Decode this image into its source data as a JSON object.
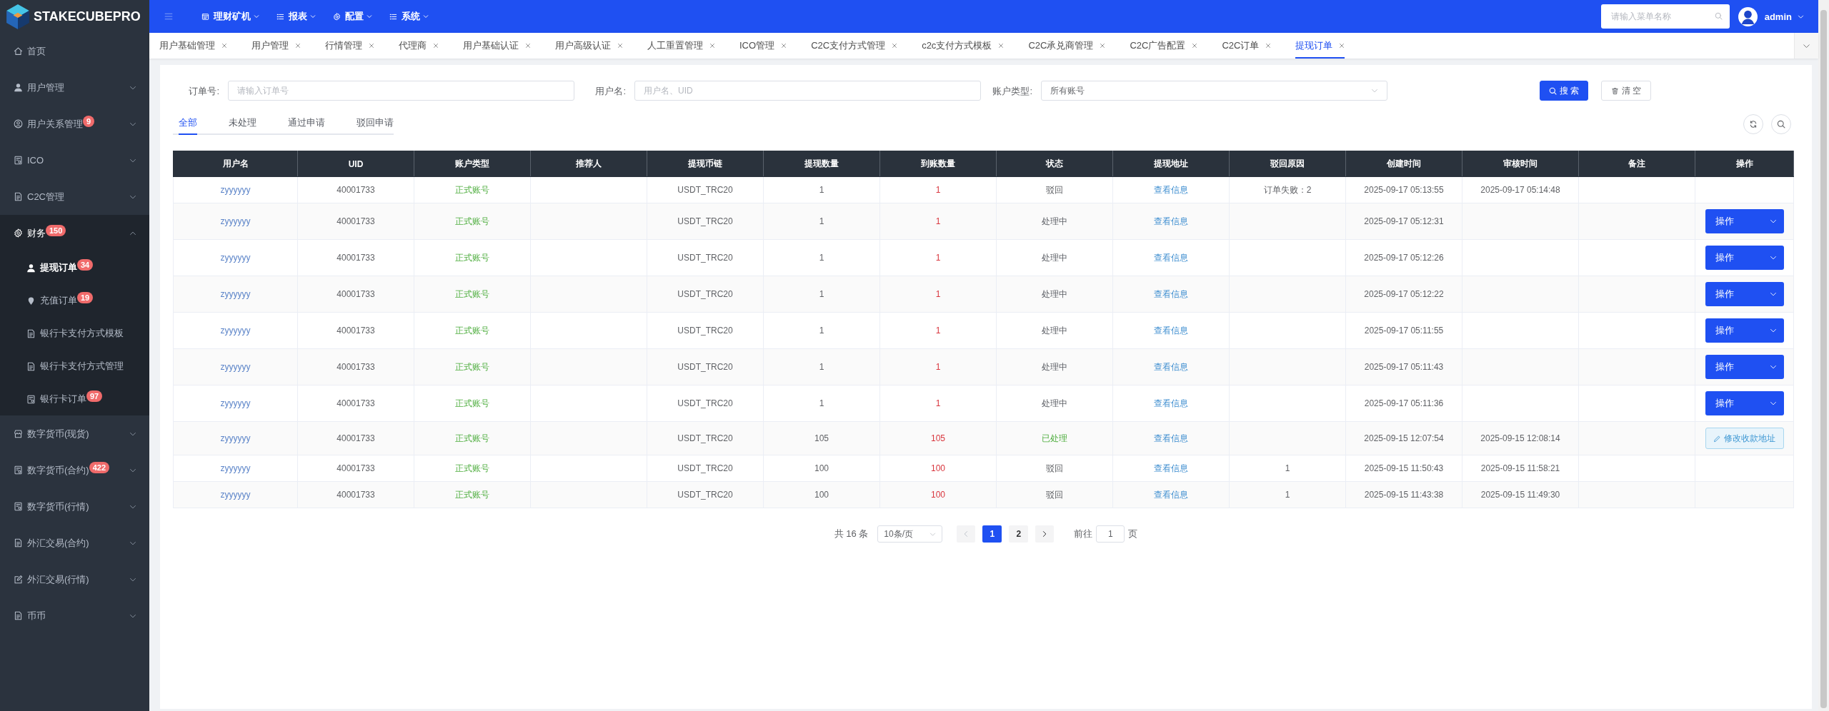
{
  "header": {
    "logo_text": "STAKECUBEPRO",
    "menu": [
      {
        "label": "理财矿机"
      },
      {
        "label": "报表"
      },
      {
        "label": "配置"
      },
      {
        "label": "系统"
      }
    ],
    "menu_search": {
      "placeholder": "请输入菜单名称"
    },
    "user": {
      "name": "admin"
    }
  },
  "sidebar": {
    "items": [
      {
        "label": "首页",
        "selected": false
      },
      {
        "label": "用户管理",
        "selected": false,
        "expanded": false
      },
      {
        "label": "用户关系管理",
        "badge": "9",
        "selected": false,
        "expanded": false
      },
      {
        "label": "ICO",
        "selected": false,
        "expanded": false
      },
      {
        "label": "C2C管理",
        "selected": false,
        "expanded": false
      },
      {
        "label": "财务",
        "badge": "150",
        "selected": false,
        "expanded": true,
        "children": [
          {
            "label": "提现订单",
            "badge": "34",
            "selected": true
          },
          {
            "label": "充值订单",
            "badge": "19",
            "selected": false
          },
          {
            "label": "银行卡支付方式模板",
            "selected": false
          },
          {
            "label": "银行卡支付方式管理",
            "selected": false
          },
          {
            "label": "银行卡订单",
            "badge": "97",
            "selected": false
          }
        ]
      },
      {
        "label": "数字货币(现货)",
        "selected": false,
        "expanded": false
      },
      {
        "label": "数字货币(合约)",
        "badge": "422",
        "selected": false,
        "expanded": false
      },
      {
        "label": "数字货币(行情)",
        "selected": false,
        "expanded": false
      },
      {
        "label": "外汇交易(合约)",
        "selected": false,
        "expanded": false
      },
      {
        "label": "外汇交易(行情)",
        "selected": false,
        "expanded": false
      },
      {
        "label": "币币",
        "selected": false,
        "expanded": false
      }
    ]
  },
  "tabs": [
    {
      "label": "用户基础管理",
      "selected": false
    },
    {
      "label": "用户管理",
      "selected": false
    },
    {
      "label": "行情管理",
      "selected": false
    },
    {
      "label": "代理商",
      "selected": false
    },
    {
      "label": "用户基础认证",
      "selected": false
    },
    {
      "label": "用户高级认证",
      "selected": false
    },
    {
      "label": "人工重置管理",
      "selected": false
    },
    {
      "label": "ICO管理",
      "selected": false
    },
    {
      "label": "C2C支付方式管理",
      "selected": false
    },
    {
      "label": "c2c支付方式模板",
      "selected": false
    },
    {
      "label": "C2C承兑商管理",
      "selected": false
    },
    {
      "label": "C2C广告配置",
      "selected": false
    },
    {
      "label": "C2C订单",
      "selected": false
    },
    {
      "label": "提现订单",
      "selected": true
    }
  ],
  "filters": [
    {
      "kind": "input",
      "label": "订单号:",
      "placeholder": "请输入订单号"
    },
    {
      "kind": "input",
      "label": "用户名:",
      "placeholder": "用户名、UID"
    },
    {
      "kind": "select",
      "label": "账户类型:",
      "value": "所有账号"
    }
  ],
  "filter_buttons": [
    {
      "kind": "primary",
      "label": "搜 索"
    },
    {
      "kind": "default",
      "label": "清 空"
    }
  ],
  "status_tabs": [
    {
      "label": "全部",
      "selected": true
    },
    {
      "label": "未处理",
      "selected": false
    },
    {
      "label": "通过申请",
      "selected": false
    },
    {
      "label": "驳回申请",
      "selected": false
    }
  ],
  "table": {
    "columns": [
      "用户名",
      "UID",
      "账户类型",
      "推荐人",
      "提现币链",
      "提现数量",
      "到账数量",
      "状态",
      "提现地址",
      "驳回原因",
      "创建时间",
      "审核时间",
      "备注",
      "操作"
    ],
    "rows": [
      {
        "username": "zyyyyyy",
        "uid": "40001733",
        "account_type": "正式账号",
        "chain": "USDT_TRC20",
        "amount": "1",
        "received": "1",
        "status": {
          "kind": "rejected",
          "text": "驳回"
        },
        "address": "查看信息",
        "reject_reason": "订单失败：2",
        "created": "2025-09-17 05:13:55",
        "audited": "2025-09-17 05:14:48"
      },
      {
        "username": "zyyyyyy",
        "uid": "40001733",
        "account_type": "正式账号",
        "chain": "USDT_TRC20",
        "amount": "1",
        "received": "1",
        "status": {
          "kind": "processing",
          "text": "处理中"
        },
        "address": "查看信息",
        "created": "2025-09-17 05:12:31",
        "action": {
          "kind": "dropdown",
          "label": "操作"
        }
      },
      {
        "username": "zyyyyyy",
        "uid": "40001733",
        "account_type": "正式账号",
        "chain": "USDT_TRC20",
        "amount": "1",
        "received": "1",
        "status": {
          "kind": "processing",
          "text": "处理中"
        },
        "address": "查看信息",
        "created": "2025-09-17 05:12:26",
        "action": {
          "kind": "dropdown",
          "label": "操作"
        }
      },
      {
        "username": "zyyyyyy",
        "uid": "40001733",
        "account_type": "正式账号",
        "chain": "USDT_TRC20",
        "amount": "1",
        "received": "1",
        "status": {
          "kind": "processing",
          "text": "处理中"
        },
        "address": "查看信息",
        "created": "2025-09-17 05:12:22",
        "action": {
          "kind": "dropdown",
          "label": "操作"
        }
      },
      {
        "username": "zyyyyyy",
        "uid": "40001733",
        "account_type": "正式账号",
        "chain": "USDT_TRC20",
        "amount": "1",
        "received": "1",
        "status": {
          "kind": "processing",
          "text": "处理中"
        },
        "address": "查看信息",
        "created": "2025-09-17 05:11:55",
        "action": {
          "kind": "dropdown",
          "label": "操作"
        }
      },
      {
        "username": "zyyyyyy",
        "uid": "40001733",
        "account_type": "正式账号",
        "chain": "USDT_TRC20",
        "amount": "1",
        "received": "1",
        "status": {
          "kind": "processing",
          "text": "处理中"
        },
        "address": "查看信息",
        "created": "2025-09-17 05:11:43",
        "action": {
          "kind": "dropdown",
          "label": "操作"
        }
      },
      {
        "username": "zyyyyyy",
        "uid": "40001733",
        "account_type": "正式账号",
        "chain": "USDT_TRC20",
        "amount": "1",
        "received": "1",
        "status": {
          "kind": "processing",
          "text": "处理中"
        },
        "address": "查看信息",
        "created": "2025-09-17 05:11:36",
        "action": {
          "kind": "dropdown",
          "label": "操作"
        }
      },
      {
        "username": "zyyyyyy",
        "uid": "40001733",
        "account_type": "正式账号",
        "chain": "USDT_TRC20",
        "amount": "105",
        "received": "105",
        "status": {
          "kind": "done",
          "text": "已处理"
        },
        "address": "查看信息",
        "created": "2025-09-15 12:07:54",
        "audited": "2025-09-15 12:08:14",
        "action": {
          "kind": "edit",
          "label": "修改收款地址"
        }
      },
      {
        "username": "zyyyyyy",
        "uid": "40001733",
        "account_type": "正式账号",
        "chain": "USDT_TRC20",
        "amount": "100",
        "received": "100",
        "status": {
          "kind": "rejected",
          "text": "驳回"
        },
        "address": "查看信息",
        "reject_reason": "1",
        "created": "2025-09-15 11:50:43",
        "audited": "2025-09-15 11:58:21"
      },
      {
        "username": "zyyyyyy",
        "uid": "40001733",
        "account_type": "正式账号",
        "chain": "USDT_TRC20",
        "amount": "100",
        "received": "100",
        "status": {
          "kind": "rejected",
          "text": "驳回"
        },
        "address": "查看信息",
        "reject_reason": "1",
        "created": "2025-09-15 11:43:38",
        "audited": "2025-09-15 11:49:30"
      }
    ]
  },
  "pagination": {
    "total": "共 16 条",
    "page_size": "10条/页",
    "prev": {
      "disabled": true
    },
    "pages": [
      {
        "label": "1",
        "selected": true
      },
      {
        "label": "2",
        "selected": false
      }
    ],
    "next": {
      "disabled": false
    },
    "jumper": {
      "label": "前往",
      "value": "1",
      "unit": "页"
    }
  }
}
